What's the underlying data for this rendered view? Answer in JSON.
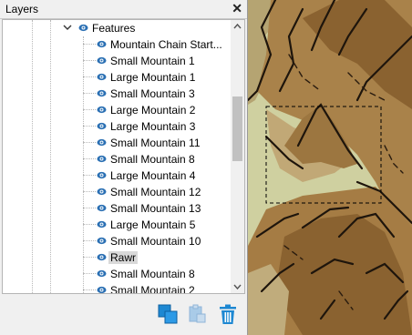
{
  "panel": {
    "title": "Layers",
    "close_symbol": "✕"
  },
  "tree": {
    "parent": {
      "label": "Features",
      "expanded": true
    },
    "items": [
      {
        "label": "Mountain Chain Start..."
      },
      {
        "label": "Small Mountain 1"
      },
      {
        "label": "Large Mountain 1"
      },
      {
        "label": "Small Mountain 3"
      },
      {
        "label": "Large Mountain 2"
      },
      {
        "label": "Large Mountain 3"
      },
      {
        "label": "Small Mountain 11"
      },
      {
        "label": "Small Mountain 8"
      },
      {
        "label": "Large Mountain 4"
      },
      {
        "label": "Small Mountain 12"
      },
      {
        "label": "Small Mountain 13"
      },
      {
        "label": "Large Mountain 5"
      },
      {
        "label": "Small Mountain 10"
      },
      {
        "label": "Rawr",
        "selected": true
      },
      {
        "label": "Small Mountain 8"
      },
      {
        "label": "Small Mountain 2"
      }
    ],
    "scroll": {
      "position": 0.35,
      "visible_fraction": 0.26
    }
  },
  "toolbar": {
    "buttons": [
      {
        "name": "duplicate-layer-button",
        "icon": "duplicate-layers-icon",
        "enabled": true
      },
      {
        "name": "paste-layer-button",
        "icon": "clipboard-icon",
        "enabled": false
      },
      {
        "name": "delete-layer-button",
        "icon": "trash-icon",
        "enabled": true
      }
    ]
  },
  "colors": {
    "accent": "#1e88d2",
    "eye": "#2a6fb3",
    "selection": "#d9d9d9"
  }
}
